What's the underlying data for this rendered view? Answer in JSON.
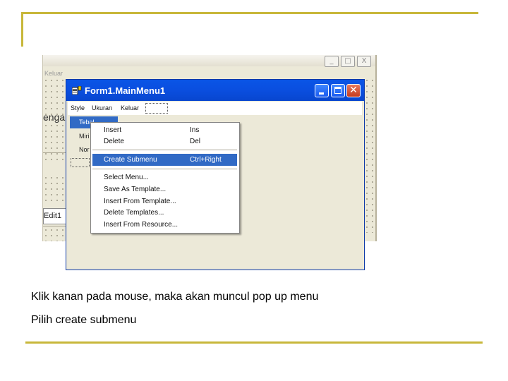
{
  "background_window": {
    "menu_partial": "Keluar",
    "partial_label": "enga",
    "edit_label": "Edit1",
    "buttons": [
      "_",
      "□",
      "X"
    ]
  },
  "menu_designer": {
    "title": "Form1.MainMenu1",
    "menubar": [
      "Style",
      "Ukuran",
      "Keluar"
    ],
    "submenu_items": [
      "Tebal",
      "Miri",
      "Nor"
    ],
    "selected_item": "Tebal"
  },
  "popup_menu": {
    "items": [
      {
        "label": "Insert",
        "shortcut": "Ins"
      },
      {
        "label": "Delete",
        "shortcut": "Del"
      },
      {
        "label": "Create Submenu",
        "shortcut": "Ctrl+Right",
        "highlighted": true
      },
      {
        "label": "Select Menu...",
        "shortcut": ""
      },
      {
        "label": "Save As Template...",
        "shortcut": ""
      },
      {
        "label": "Insert From Template...",
        "shortcut": ""
      },
      {
        "label": "Delete Templates...",
        "shortcut": ""
      },
      {
        "label": "Insert From Resource...",
        "shortcut": ""
      }
    ]
  },
  "caption": {
    "line1": "Klik kanan pada mouse, maka akan muncul pop up menu",
    "line2": "Pilih create submenu"
  },
  "colors": {
    "accent_line": "#c8b73a",
    "titlebar_blue": "#0a55e6",
    "selection_blue": "#316ac5"
  }
}
